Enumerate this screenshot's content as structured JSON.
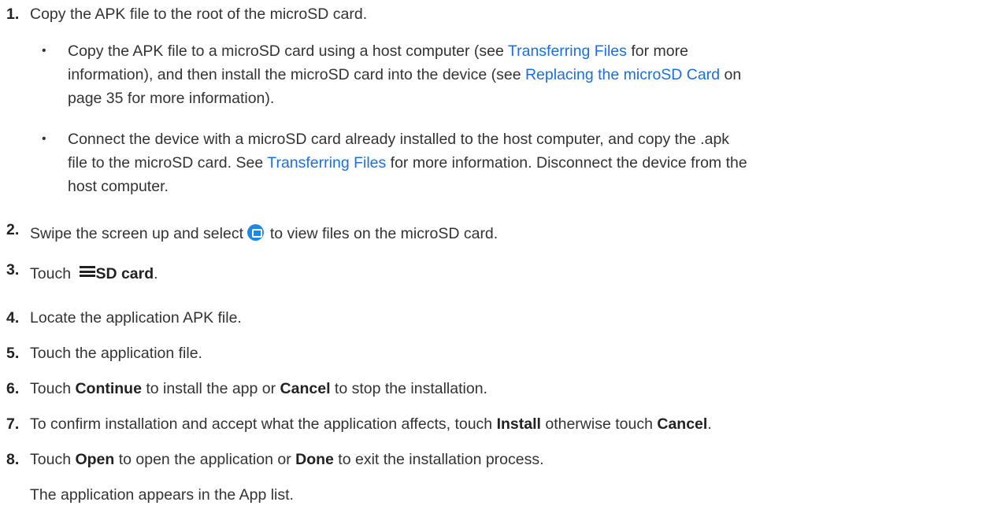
{
  "steps": {
    "s1": {
      "num": "1.",
      "text": "Copy the APK file to the root of the microSD card."
    },
    "b1": {
      "t1": "Copy the APK file to a microSD card using a host computer (see ",
      "link1": "Transferring Files",
      "t2": " for more",
      "l2a": "information), and then install the microSD card into the device (see ",
      "link2": "Replacing the microSD Card",
      "l2b": " on",
      "l3": "page 35 for more information)."
    },
    "b2": {
      "l1": "Connect the device with a microSD card already installed to the host computer, and copy the .apk",
      "l2a": "file to the microSD card. See ",
      "link": "Transferring Files",
      "l2b": " for more information. Disconnect the device from the",
      "l3": "host computer."
    },
    "s2": {
      "num": "2.",
      "pre": "Swipe the screen up and select ",
      "icon": "files-app-icon",
      "post": " to view files on the microSD card."
    },
    "s3": {
      "num": "3.",
      "pre": "Touch ",
      "icon": "hamburger-menu-icon",
      "bold": "SD card",
      "post": "."
    },
    "s4": {
      "num": "4.",
      "text": "Locate the application APK file."
    },
    "s5": {
      "num": "5.",
      "text": "Touch the application file."
    },
    "s6": {
      "num": "6.",
      "pre": "Touch ",
      "b1": "Continue",
      "mid": " to install the app or ",
      "b2": "Cancel",
      "post": " to stop the installation."
    },
    "s7": {
      "num": "7.",
      "pre": "To confirm installation and accept what the application affects, touch ",
      "b1": "Install",
      "mid": " otherwise touch ",
      "b2": "Cancel",
      "post": "."
    },
    "s8": {
      "num": "8.",
      "pre": "Touch ",
      "b1": "Open",
      "mid": " to open the application or ",
      "b2": "Done",
      "post": " to exit the installation process."
    },
    "result": "The application appears in the App list."
  },
  "colors": {
    "text": "#333333",
    "link": "#1a6fe0",
    "icon": "#1e88e5"
  }
}
